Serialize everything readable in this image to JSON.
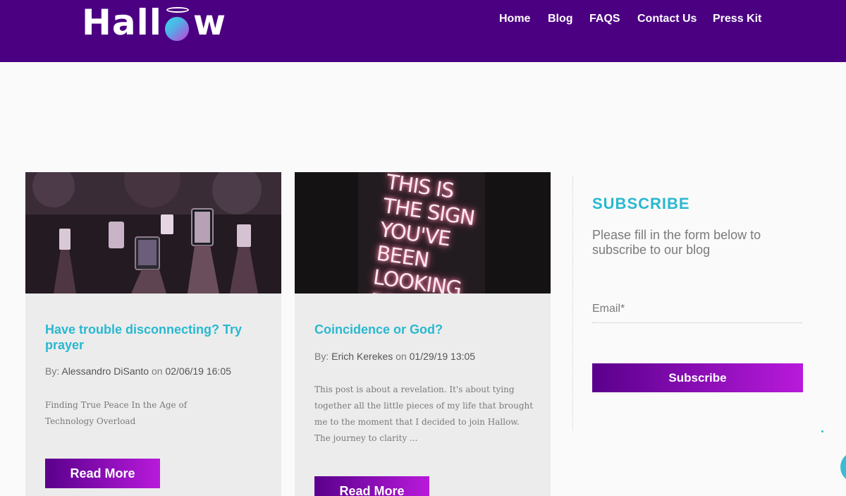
{
  "header": {
    "logo_text": "Hallow",
    "background": "#4b0082",
    "nav": [
      "Home",
      "Blog",
      "FAQS",
      "Contact Us",
      "Press Kit"
    ]
  },
  "posts": [
    {
      "title": "Have trouble disconnecting? Try prayer",
      "by_label": "By:",
      "author": "Alessandro DiSanto",
      "on_label": "on",
      "date": "02/06/19 16:05",
      "excerpt": "Finding True Peace In the Age of Technology Overload",
      "read_more": "Read More",
      "image_icon": "concert-phones-image"
    },
    {
      "title": "Coincidence or God?",
      "by_label": "By:",
      "author": "Erich Kerekes",
      "on_label": "on",
      "date": "01/29/19 13:05",
      "excerpt": "This post is about a revelation. It's about tying together all the little pieces of my life that brought me to the moment that I decided to join Hallow. The journey to clarity ...",
      "read_more": "Read More",
      "image_text": "THIS IS THE SIGN YOU'VE BEEN LOOKING FOR"
    }
  ],
  "sidebar": {
    "title": "SUBSCRIBE",
    "description": "Please fill in the form below to subscribe to our blog",
    "email_label": "Email*",
    "email_value": "",
    "button": "Subscribe"
  },
  "colors": {
    "accent": "#29b8d0",
    "button_start": "#5a008c",
    "button_end": "#b81adb"
  }
}
